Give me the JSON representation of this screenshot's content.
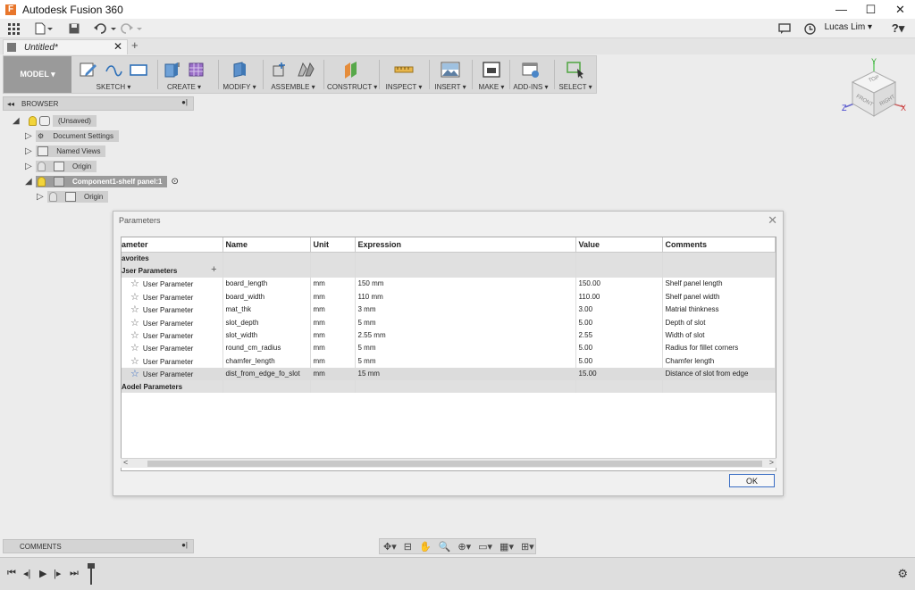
{
  "window": {
    "title": "Autodesk Fusion 360",
    "logo_letter": "F"
  },
  "window_controls": {
    "minimize": "—",
    "maximize": "☐",
    "close": "✕"
  },
  "quick_access": {
    "user_name": "Lucas Lim ▾",
    "help": "?▾"
  },
  "tabs": {
    "document_name": "Untitled*",
    "close": "✕",
    "new_tab": "+"
  },
  "toolbar": {
    "workspace": "MODEL ▾",
    "groups": [
      {
        "label": "SKETCH ▾"
      },
      {
        "label": "CREATE ▾"
      },
      {
        "label": "MODIFY ▾"
      },
      {
        "label": "ASSEMBLE ▾"
      },
      {
        "label": "CONSTRUCT ▾"
      },
      {
        "label": "INSPECT ▾"
      },
      {
        "label": "INSERT ▾"
      },
      {
        "label": "MAKE ▾"
      },
      {
        "label": "ADD-INS ▾"
      },
      {
        "label": "SELECT ▾"
      }
    ]
  },
  "viewcube": {
    "top": "TOP",
    "front": "FRONT",
    "right": "RIGHT",
    "x": "X",
    "y": "Y",
    "z": "Z"
  },
  "browser": {
    "header": "BROWSER",
    "root": "(Unsaved)",
    "items": [
      "Document Settings",
      "Named Views",
      "Origin"
    ],
    "component": "Component1-shelf panel:1",
    "component_child": "Origin"
  },
  "parameters_dialog": {
    "title": "Parameters",
    "columns": [
      "ameter",
      "Name",
      "Unit",
      "Expression",
      "Value",
      "Comments"
    ],
    "group_favorites": "avorites",
    "group_user": "Jser Parameters",
    "group_model": "Aodel Parameters",
    "rows": [
      {
        "type": "User Parameter",
        "name": "board_length",
        "unit": "mm",
        "expression": "150 mm",
        "value": "150.00",
        "comment": "Shelf panel length"
      },
      {
        "type": "User Parameter",
        "name": "board_width",
        "unit": "mm",
        "expression": "110 mm",
        "value": "110.00",
        "comment": "Shelf panel width"
      },
      {
        "type": "User Parameter",
        "name": "mat_thk",
        "unit": "mm",
        "expression": "3 mm",
        "value": "3.00",
        "comment": "Matrial thinkness"
      },
      {
        "type": "User Parameter",
        "name": "slot_depth",
        "unit": "mm",
        "expression": "5 mm",
        "value": "5.00",
        "comment": "Depth of slot"
      },
      {
        "type": "User Parameter",
        "name": "slot_width",
        "unit": "mm",
        "expression": "2.55 mm",
        "value": "2.55",
        "comment": "Width of slot"
      },
      {
        "type": "User Parameter",
        "name": "round_cm_radius",
        "unit": "mm",
        "expression": "5 mm",
        "value": "5.00",
        "comment": "Radius for fillet corners"
      },
      {
        "type": "User Parameter",
        "name": "chamfer_length",
        "unit": "mm",
        "expression": "5 mm",
        "value": "5.00",
        "comment": "Chamfer length"
      },
      {
        "type": "User Parameter",
        "name": "dist_from_edge_fo_slot",
        "unit": "mm",
        "expression": "15 mm",
        "value": "15.00",
        "comment": "Distance of slot from edge"
      }
    ],
    "ok_label": "OK"
  },
  "comments_bar": {
    "label": "COMMENTS"
  },
  "colors": {
    "accent_blue": "#3a6ec4",
    "toolbar_bg": "#d9d9d9",
    "selected_row": "#dcdcdc"
  }
}
